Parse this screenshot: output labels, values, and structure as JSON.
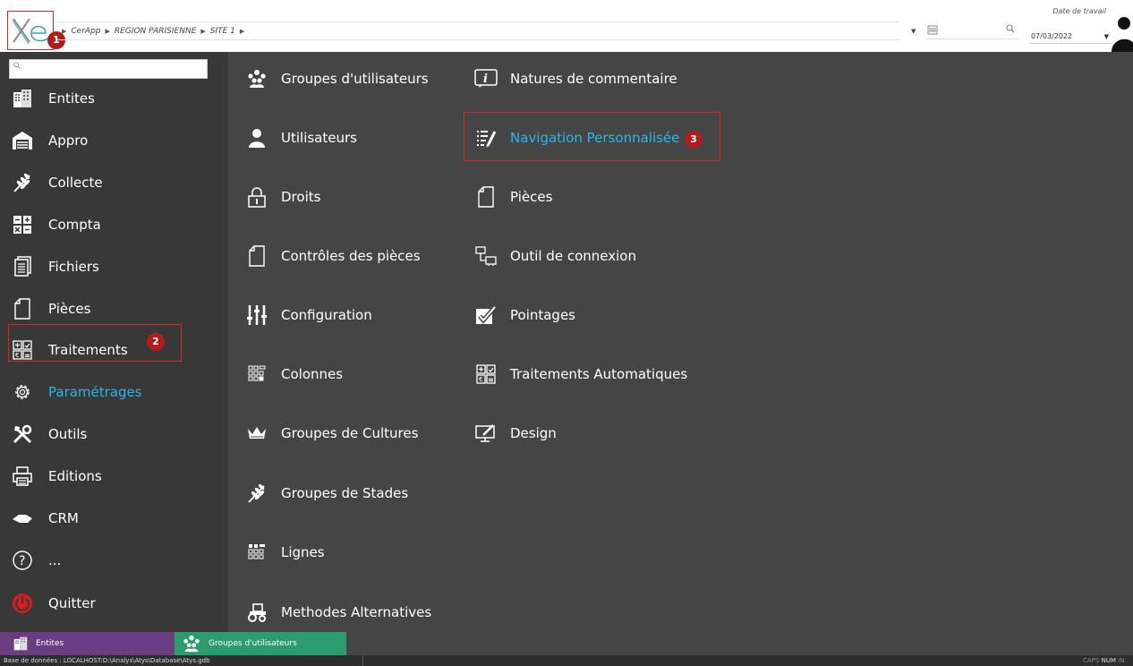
{
  "breadcrumb": {
    "items": [
      "CerApp",
      "REGION PARISIENNE",
      "SITE 1"
    ]
  },
  "header": {
    "date_label": "Date de travail",
    "date_value": "07/03/2022"
  },
  "annotations": {
    "badge1": "1",
    "badge2": "2",
    "badge3": "3"
  },
  "sidebar": {
    "items": [
      {
        "label": "Entites",
        "icon": "buildings-icon"
      },
      {
        "label": "Appro",
        "icon": "warehouse-icon"
      },
      {
        "label": "Collecte",
        "icon": "wheat-icon"
      },
      {
        "label": "Compta",
        "icon": "calculator-icon"
      },
      {
        "label": "Fichiers",
        "icon": "files-icon"
      },
      {
        "label": "Pièces",
        "icon": "document-icon"
      },
      {
        "label": "Traitements",
        "icon": "process-icon"
      },
      {
        "label": "Paramétrages",
        "icon": "gear-icon",
        "active": true
      },
      {
        "label": "Outils",
        "icon": "tools-icon"
      },
      {
        "label": "Editions",
        "icon": "printer-icon"
      },
      {
        "label": "CRM",
        "icon": "handshake-icon"
      },
      {
        "label": "...",
        "icon": "help-icon"
      },
      {
        "label": "Quitter",
        "icon": "power-icon"
      }
    ]
  },
  "menu": {
    "col1": [
      {
        "label": "Groupes d'utilisateurs",
        "icon": "users-group-icon"
      },
      {
        "label": "Utilisateurs",
        "icon": "user-icon"
      },
      {
        "label": "Droits",
        "icon": "lock-icon"
      },
      {
        "label": "Contrôles des pièces",
        "icon": "document-icon"
      },
      {
        "label": "Configuration",
        "icon": "sliders-icon"
      },
      {
        "label": "Colonnes",
        "icon": "columns-grid-icon"
      },
      {
        "label": "Groupes de Cultures",
        "icon": "crown-icon"
      },
      {
        "label": "Groupes de Stades",
        "icon": "wheat-icon"
      },
      {
        "label": "Lignes",
        "icon": "lines-grid-icon"
      },
      {
        "label": "Methodes Alternatives",
        "icon": "tractor-icon"
      }
    ],
    "col2": [
      {
        "label": "Natures de commentaire",
        "icon": "info-icon"
      },
      {
        "label": "Navigation Personnalisée",
        "icon": "list-edit-icon",
        "active": true
      },
      {
        "label": "Pièces",
        "icon": "document-icon"
      },
      {
        "label": "Outil de connexion",
        "icon": "network-icon"
      },
      {
        "label": "Pointages",
        "icon": "checkbox-icon"
      },
      {
        "label": "Traitements Automatiques",
        "icon": "process-icon"
      },
      {
        "label": "Design",
        "icon": "monitor-edit-icon"
      }
    ]
  },
  "tabs": [
    {
      "label": "Entites",
      "icon": "buildings-icon",
      "color": "#6a3d82"
    },
    {
      "label": "Groupes d'utilisateurs",
      "icon": "users-group-icon",
      "color": "#2a9c6e"
    }
  ],
  "status": {
    "database": "Base de données : LOCALHOST:D:\\Analys\\Atys\\Database\\Atys.gdb",
    "caps": "CAPS",
    "num": "NUM",
    "ins": "IN"
  },
  "colors": {
    "accent": "#29b6e8",
    "highlight": "#d62828",
    "badge": "#b01c1c",
    "sidebar_bg": "#383838",
    "main_bg": "#454545"
  }
}
